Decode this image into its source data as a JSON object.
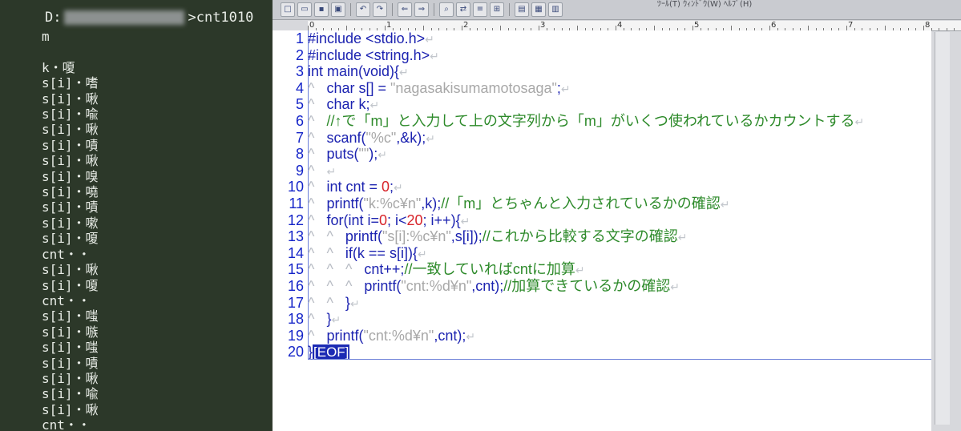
{
  "console": {
    "path_start": "D:",
    "path_end": ">cnt1010",
    "lines": [
      "m",
      "",
      "k・嗄",
      "s[i]・嗜",
      "s[i]・啾",
      "s[i]・喩",
      "s[i]・啾",
      "s[i]・嘖",
      "s[i]・啾",
      "s[i]・嗅",
      "s[i]・嘵",
      "s[i]・嘖",
      "s[i]・嗽",
      "s[i]・嗄",
      "cnt・・",
      "s[i]・啾",
      "s[i]・嗄",
      "cnt・・",
      "s[i]・嗤",
      "s[i]・嗾",
      "s[i]・嗤",
      "s[i]・嘖",
      "s[i]・啾",
      "s[i]・喩",
      "s[i]・啾",
      "cnt・・"
    ]
  },
  "toolbar": {
    "menu_text": "ﾂｰﾙ(T)  ｳｨﾝﾄﾞｳ(W)  ﾍﾙﾌﾟ(H)",
    "buttons": [
      "new",
      "open",
      "save",
      "save-all",
      "undo",
      "redo",
      "back",
      "forward",
      "search",
      "replace",
      "grep",
      "compare",
      "outline",
      "setting",
      "window"
    ]
  },
  "ruler": {
    "labels": [
      "0",
      "1",
      "2",
      "3",
      "4",
      "5",
      "6",
      "7",
      "8"
    ]
  },
  "editor": {
    "line_numbers": [
      "1",
      "2",
      "3",
      "4",
      "5",
      "6",
      "7",
      "8",
      "9",
      "10",
      "11",
      "12",
      "13",
      "14",
      "15",
      "16",
      "17",
      "18",
      "19",
      "20"
    ],
    "eof": "[EOF]",
    "lines": [
      {
        "tabs": 0,
        "text": "#include <stdio.h>"
      },
      {
        "tabs": 0,
        "text": "#include <string.h>"
      },
      {
        "tabs": 0,
        "text": "int main(void){"
      },
      {
        "tabs": 1,
        "text": "char s[] = \"nagasakisumamotosaga\";"
      },
      {
        "tabs": 1,
        "text": "char k;"
      },
      {
        "tabs": 1,
        "text": "//↑で「m」と入力して上の文字列から「m」がいくつ使われているかカウントする"
      },
      {
        "tabs": 1,
        "text": "scanf(\"%c\",&k);"
      },
      {
        "tabs": 1,
        "text": "puts(\"\");"
      },
      {
        "tabs": 1,
        "text": ""
      },
      {
        "tabs": 1,
        "text": "int cnt = 0;"
      },
      {
        "tabs": 1,
        "text": "printf(\"k:%c¥n\",k);//「m」とちゃんと入力されているかの確認"
      },
      {
        "tabs": 1,
        "text": "for(int i=0; i<20; i++){"
      },
      {
        "tabs": 2,
        "text": "printf(\"s[i]:%c¥n\",s[i]);//これから比較する文字の確認"
      },
      {
        "tabs": 2,
        "text": "if(k == s[i]){"
      },
      {
        "tabs": 3,
        "text": "cnt++;//一致していればcntに加算"
      },
      {
        "tabs": 3,
        "text": "printf(\"cnt:%d¥n\",cnt);//加算できているかの確認"
      },
      {
        "tabs": 2,
        "text": "}"
      },
      {
        "tabs": 1,
        "text": "}"
      },
      {
        "tabs": 1,
        "text": "printf(\"cnt:%d¥n\",cnt);"
      },
      {
        "tabs": 0,
        "text": "}"
      }
    ]
  },
  "colors": {
    "keyword": "#1c23b0",
    "comment": "#2d8a2a",
    "number": "#d8242a",
    "string": "#a8a8a8",
    "eof_bg": "#1c2bb4"
  }
}
